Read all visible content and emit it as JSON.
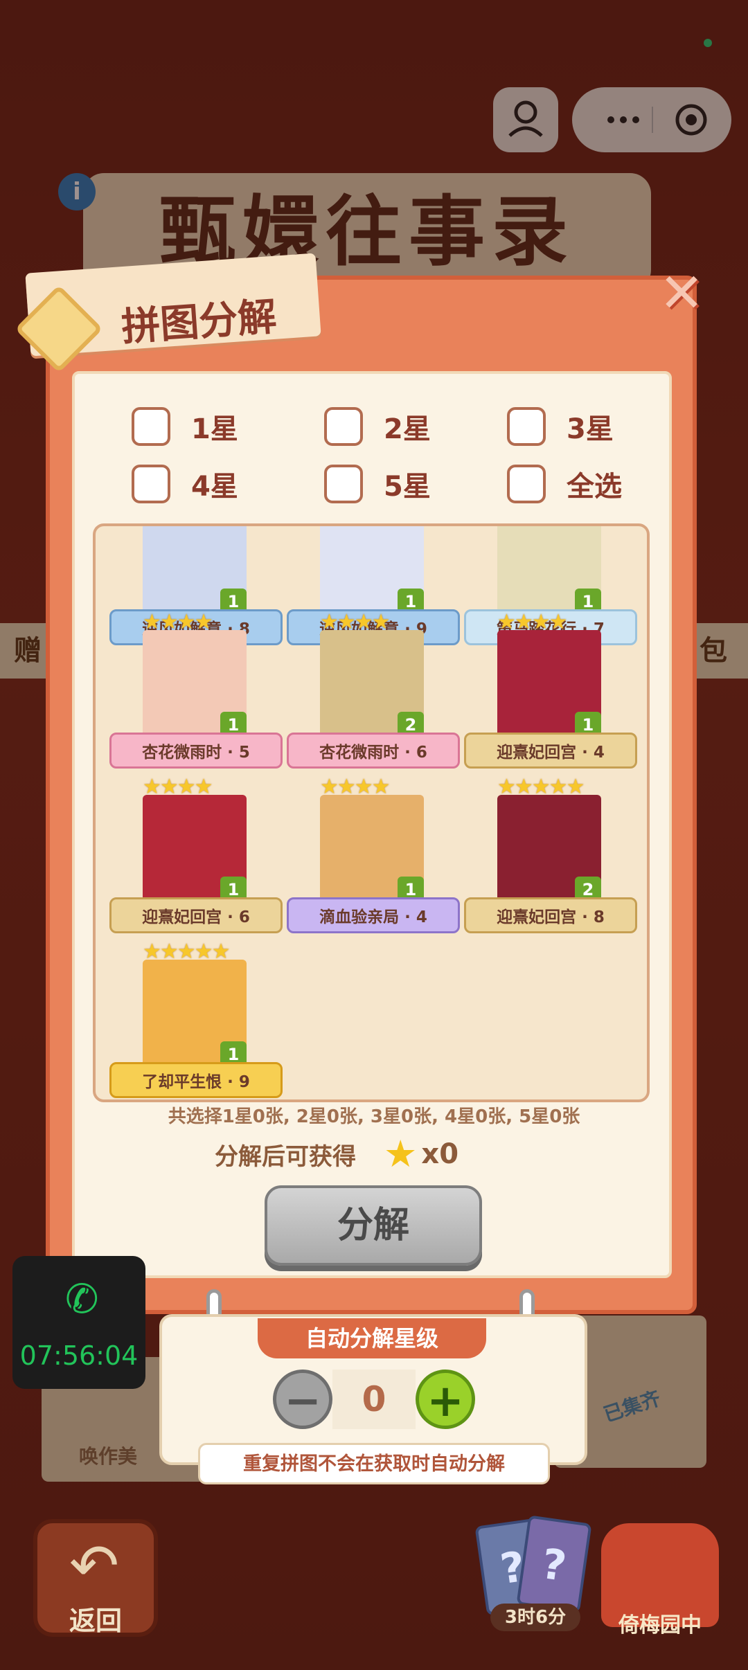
{
  "background": {
    "game_title": "甄嬛往事录",
    "left_tab": "赠",
    "right_tab": "包",
    "card_left_label": "唤作美",
    "stamp_label": "已集齐"
  },
  "modal": {
    "title": "拼图分解",
    "filters": [
      {
        "label": "1星",
        "checked": false
      },
      {
        "label": "2星",
        "checked": false
      },
      {
        "label": "3星",
        "checked": false
      },
      {
        "label": "4星",
        "checked": false
      },
      {
        "label": "5星",
        "checked": false
      },
      {
        "label": "全选",
        "checked": false
      }
    ],
    "cards": [
      {
        "name": "逆风如解意 · 8",
        "stars": "",
        "count": "1",
        "style": "blue"
      },
      {
        "name": "逆风如解意 · 9",
        "stars": "",
        "count": "1",
        "style": "blue"
      },
      {
        "name": "策马踏花行 · 7",
        "stars": "",
        "count": "1",
        "style": "light"
      },
      {
        "name": "杏花微雨时 · 5",
        "stars": "★★★★",
        "count": "1",
        "style": "pink"
      },
      {
        "name": "杏花微雨时 · 6",
        "stars": "★★★★",
        "count": "2",
        "style": "pink"
      },
      {
        "name": "迎熹妃回宫 · 4",
        "stars": "★★★★",
        "count": "1",
        "style": "tan"
      },
      {
        "name": "迎熹妃回宫 · 6",
        "stars": "★★★★",
        "count": "1",
        "style": "tan"
      },
      {
        "name": "滴血验亲局 · 4",
        "stars": "★★★★",
        "count": "1",
        "style": "purple"
      },
      {
        "name": "迎熹妃回宫 · 8",
        "stars": "★★★★★",
        "count": "2",
        "style": "tan"
      },
      {
        "name": "了却平生恨 · 9",
        "stars": "★★★★★",
        "count": "1",
        "style": "gold"
      }
    ],
    "summary": "共选择1星0张, 2星0张, 3星0张, 4星0张, 5星0张",
    "gain_label": "分解后可获得",
    "gain_value": "x0",
    "decompose_button": "分解"
  },
  "auto_panel": {
    "title": "自动分解星级",
    "value": "0",
    "hint": "重复拼图不会在获取时自动分解"
  },
  "call": {
    "time": "07:56:04"
  },
  "bottom": {
    "back_label": "返回",
    "deck_timer": "3时6分",
    "garden_label": "倚梅园中"
  }
}
